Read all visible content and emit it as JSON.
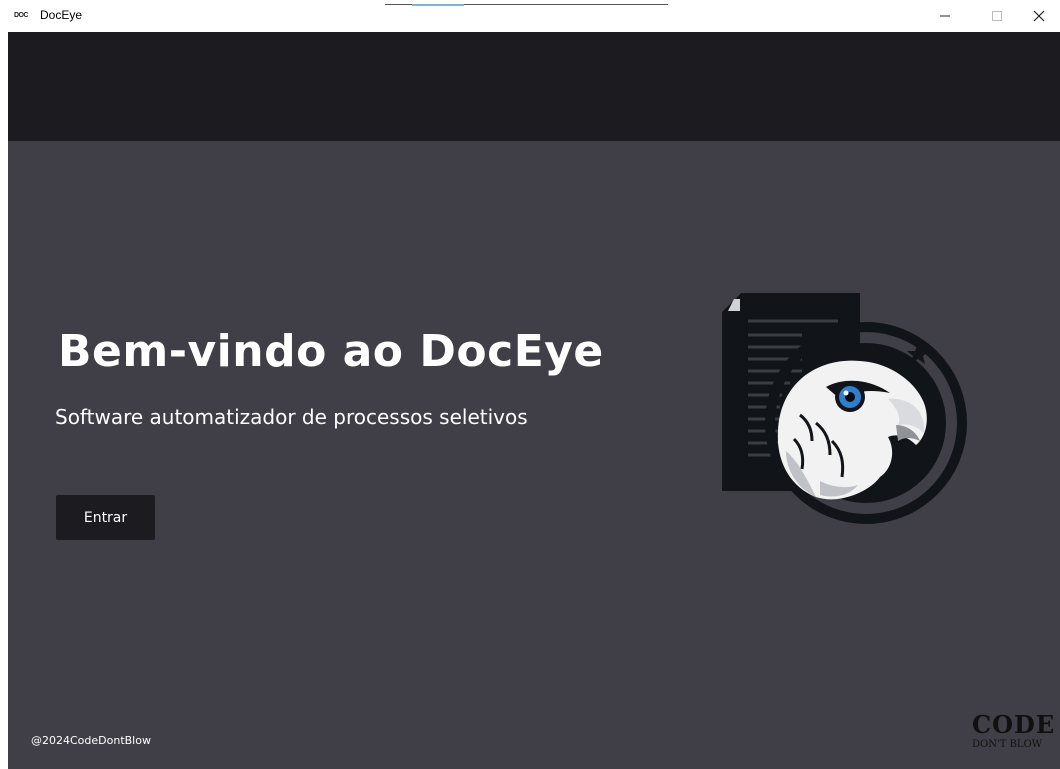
{
  "window": {
    "title": "DocEye",
    "icon": "doceye-app-icon",
    "icon_text": "DOC"
  },
  "hero": {
    "title": "Bem-vindo ao DocEye",
    "subtitle": "Software automatizador de processos seletivos",
    "enter_label": "Entrar"
  },
  "footer": {
    "copyright": "@2024CodeDontBlow"
  },
  "brand": {
    "top": "CODE",
    "bottom": "DON'T BLOW"
  },
  "colors": {
    "topbar": "#1c1b20",
    "main_bg": "#403f48",
    "button_bg": "#1c1b20",
    "eagle_eye": "#2f7fd0"
  }
}
